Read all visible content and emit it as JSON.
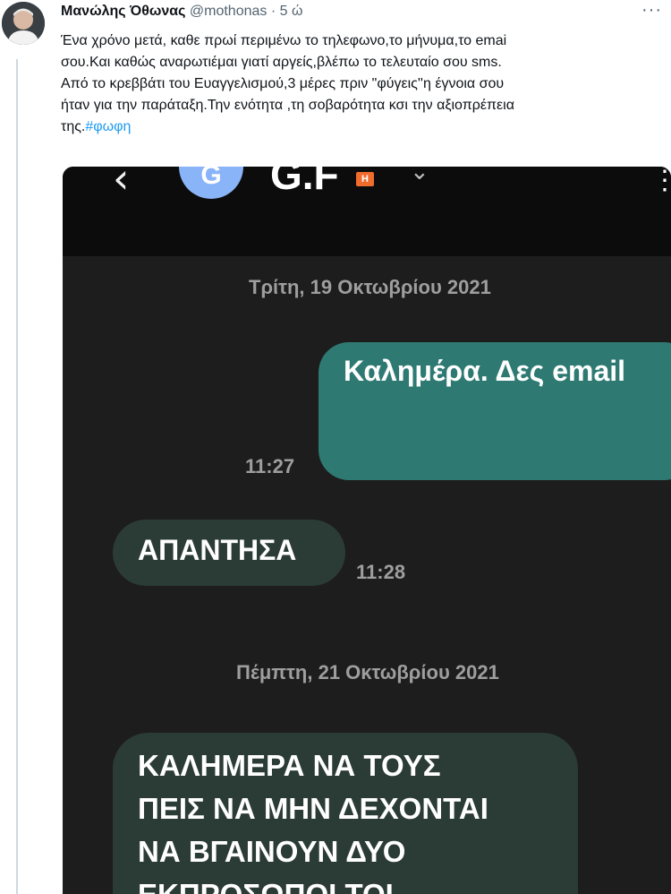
{
  "tweet": {
    "author_name": "Μανώλης Όθωνας",
    "handle": "@mothonas",
    "separator": "·",
    "time_ago": "5 ώ",
    "more": "···",
    "text_lines": [
      "Ένα χρόνο μετά, καθε πρωί περιμένω το τηλεφωνο,το μήνυμα,το emai",
      "σου.Και καθώς αναρωτιέμαι γιατί αργείς,βλέπω το τελευταίο σου sms.",
      "Από το κρεββάτι του Ευαγγελισμού,3 μέρες πριν \"φύγεις''η έγνοια σου",
      "ήταν για την παράταξη.Την  ενότητα ,τη σοβαρότητα κσι την αξιοπρέπεια"
    ],
    "last_line_prefix": "της.",
    "hashtag": "#φωφη"
  },
  "screenshot": {
    "back_glyph": "‹",
    "contact_initial": "G",
    "contact_name": "G.F",
    "badge": "H",
    "chevron": "⌄",
    "menu": "⋮",
    "day1": "Τρίτη, 19 Οκτωβρίου 2021",
    "msg1_text": "Καλημέρα. Δες email",
    "msg1_time": "11:27",
    "msg2_text": "ΑΠΑΝΤΗΣΑ",
    "msg2_time": "11:28",
    "day2": "Πέμπτη, 21 Οκτωβρίου 2021",
    "msg3_lines": [
      "ΚΑΛΗΜΕΡΑ ΝΑ ΤΟΥΣ",
      "ΠΕΙΣ ΝΑ ΜΗΝ ΔΕΧΟΝΤΑΙ",
      "ΝΑ ΒΓΑΙΝΟΥΝ ΔΥΟ",
      "ΕΚΠΡΟΣΩΠΟΙ ΤΟΙ"
    ]
  },
  "colors": {
    "hashtag": "#1d9bf0",
    "outgoing_bubble": "#2e7a73",
    "incoming_bubble": "#2b3b36",
    "chat_background": "#1d1d1d"
  }
}
